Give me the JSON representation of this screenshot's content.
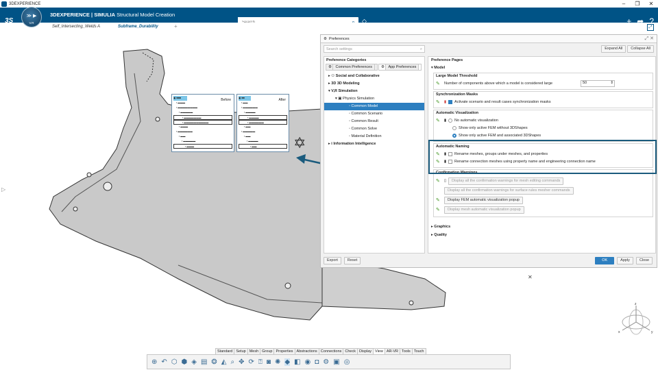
{
  "window": {
    "title": "3DEXPERIENCE",
    "controls": [
      "–",
      "❐",
      "✕"
    ]
  },
  "topbar": {
    "brand_bold": "3DEXPERIENCE | SIMULIA",
    "app_name": " Structural Model Creation",
    "search_placeholder": "Search",
    "compass_version": "V.R"
  },
  "tabs": [
    {
      "label": "Self_Intersecting_Welds A"
    },
    {
      "label": "Subframe_Durability"
    },
    {
      "label": "+"
    }
  ],
  "preferences": {
    "title": "Preferences",
    "search_placeholder": "Search settings",
    "expand_all": "Expand All",
    "collapse_all": "Collapse All",
    "left_header": "Preference Categories",
    "subtabs": [
      "Common Preferences",
      "App Preferences"
    ],
    "tree": [
      {
        "label": "Social and Collaborative",
        "indent": 0,
        "bold": true
      },
      {
        "label": "3D Modeling",
        "indent": 0,
        "bold": true
      },
      {
        "label": "Simulation",
        "indent": 0,
        "bold": true
      },
      {
        "label": "Physics Simulation",
        "indent": 1,
        "bold": false
      },
      {
        "label": "Common Model",
        "indent": 2,
        "bold": false
      },
      {
        "label": "Common Scenario",
        "indent": 2,
        "bold": false
      },
      {
        "label": "Common Result",
        "indent": 2,
        "bold": false
      },
      {
        "label": "Common Solve",
        "indent": 2,
        "bold": false
      },
      {
        "label": "Material Definition",
        "indent": 2,
        "bold": false
      },
      {
        "label": "Information Intelligence",
        "indent": 0,
        "bold": true
      }
    ],
    "right_header": "Preference Pages",
    "model_label": "Model",
    "large_model": {
      "title": "Large Model Threshold",
      "label": "Number of components above which a model is considered large",
      "value": "50"
    },
    "sync_masks": {
      "title": "Synchronization Masks",
      "label": "Activate scenario and result cases synchronization masks"
    },
    "auto_vis": {
      "title": "Automatic Visualization",
      "options": [
        "No automatic visualization",
        "Show only active FEM without 3DShapes",
        "Show only active FEM and associated 3DShapes"
      ]
    },
    "auto_naming": {
      "title": "Automatic Naming",
      "options": [
        "Rename meshes, groups under meshes, and properties",
        "Rename connection meshes using property name and engineering connection name"
      ]
    },
    "confirm": {
      "title": "Confirmation Warnings",
      "buttons": [
        "Display all the confirmation warnings for mesh editing commands",
        "Display all the confirmation warnings for surface rules mesher commands",
        "Display FEM automatic visualization popup",
        "Display mesh automatic visualization popup"
      ]
    },
    "graphics": "Graphics",
    "quality": "Quality",
    "export": "Export",
    "reset": "Reset",
    "ok": "OK",
    "apply": "Apply",
    "close": "Close"
  },
  "before_after": {
    "before": "Before",
    "after": "After"
  },
  "ribbon": {
    "tabs": [
      "Standard",
      "Setup",
      "Mesh",
      "Group",
      "Properties",
      "Abstractions",
      "Connections",
      "Check",
      "Display",
      "View",
      "AR-VR",
      "Tools",
      "Touch"
    ]
  },
  "colors": {
    "brand": "#005386",
    "accent": "#2d7fc0",
    "highlight": "#1a5b7d"
  }
}
